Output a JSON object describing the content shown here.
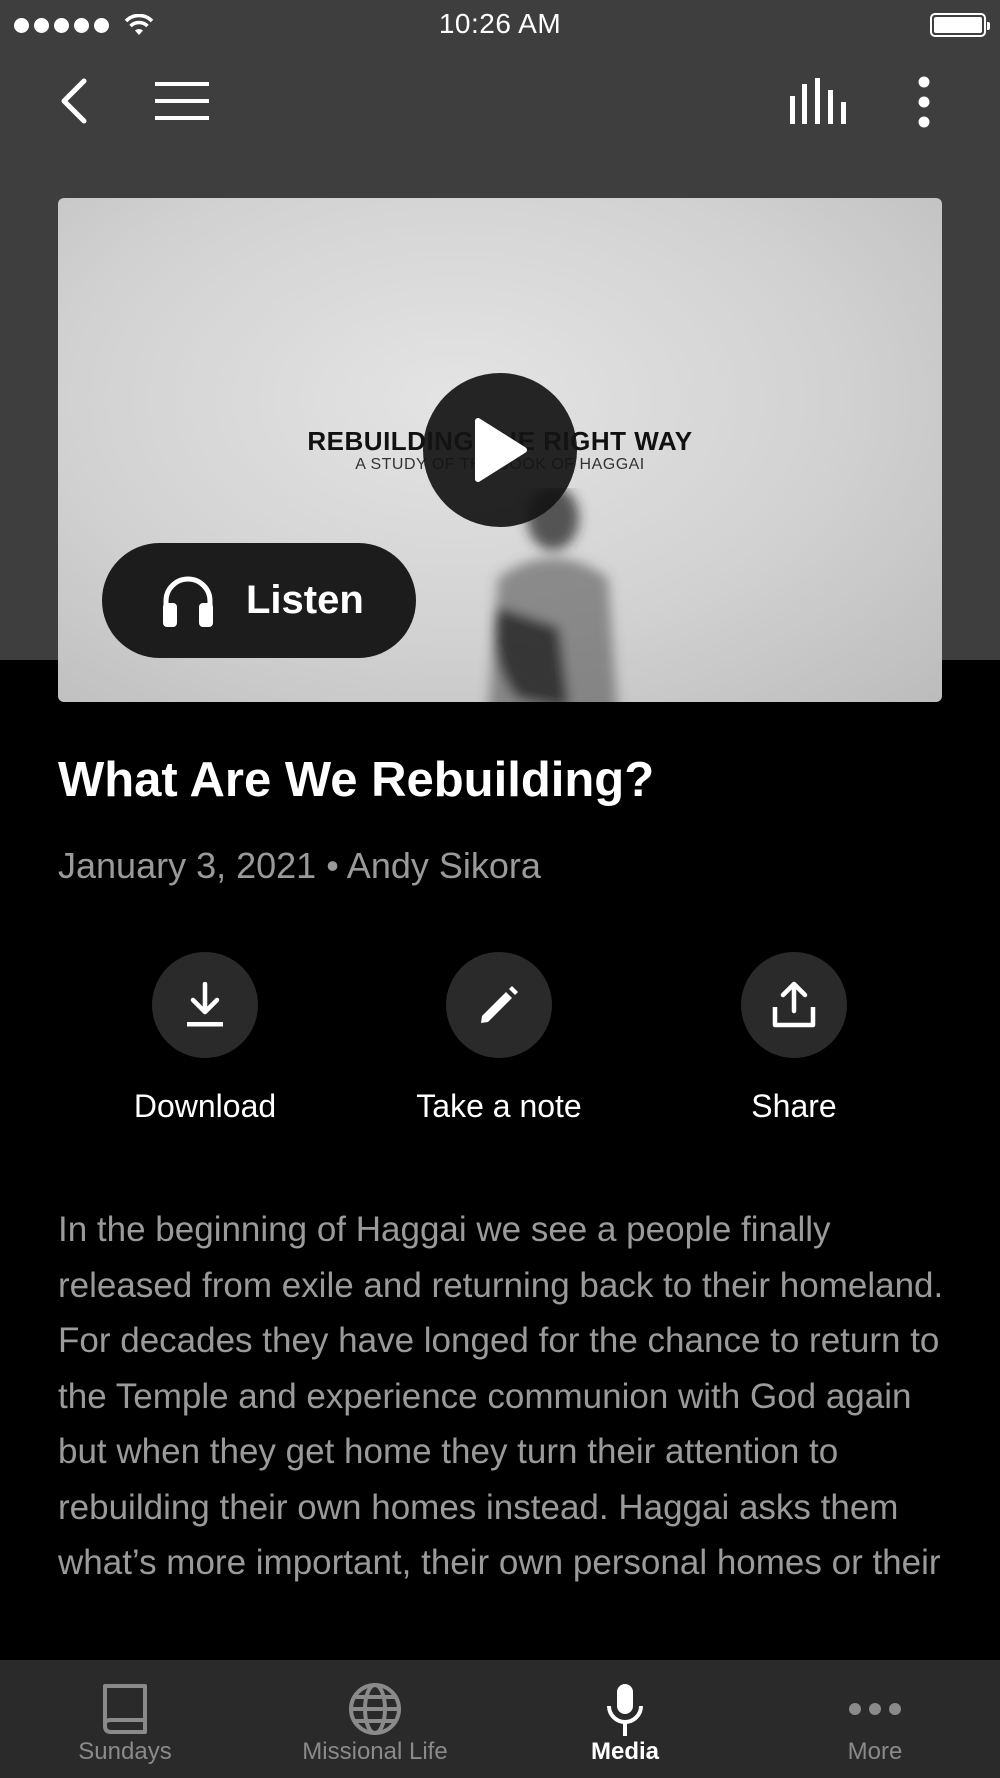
{
  "status_bar": {
    "time": "10:26 AM"
  },
  "media": {
    "series_title": "REBUILDING THE RIGHT WAY",
    "series_subtitle": "A STUDY OF THE BOOK OF HAGGAI",
    "listen_label": "Listen"
  },
  "episode": {
    "title": "What Are We Rebuilding?",
    "meta": "January 3, 2021 • Andy Sikora",
    "description": "In the beginning of Haggai we see a people finally released from exile and returning back to their homeland. For decades they have longed for the chance to return to the Temple and experience communion with God again but when they get home they turn their attention to rebuilding their own homes instead. Haggai asks them what’s more important, their own personal homes or their"
  },
  "actions": {
    "download": "Download",
    "note": "Take a note",
    "share": "Share"
  },
  "tabs": [
    {
      "label": "Sundays",
      "icon": "book-icon"
    },
    {
      "label": "Missional Life",
      "icon": "globe-icon"
    },
    {
      "label": "Media",
      "icon": "microphone-icon"
    },
    {
      "label": "More",
      "icon": "more-dots-icon"
    }
  ],
  "active_tab": "Media",
  "colors": {
    "top_background": "#3e3e3e",
    "page_background": "#000000",
    "muted_text": "#9a9a9a",
    "tab_bar": "#2a2a2a"
  }
}
